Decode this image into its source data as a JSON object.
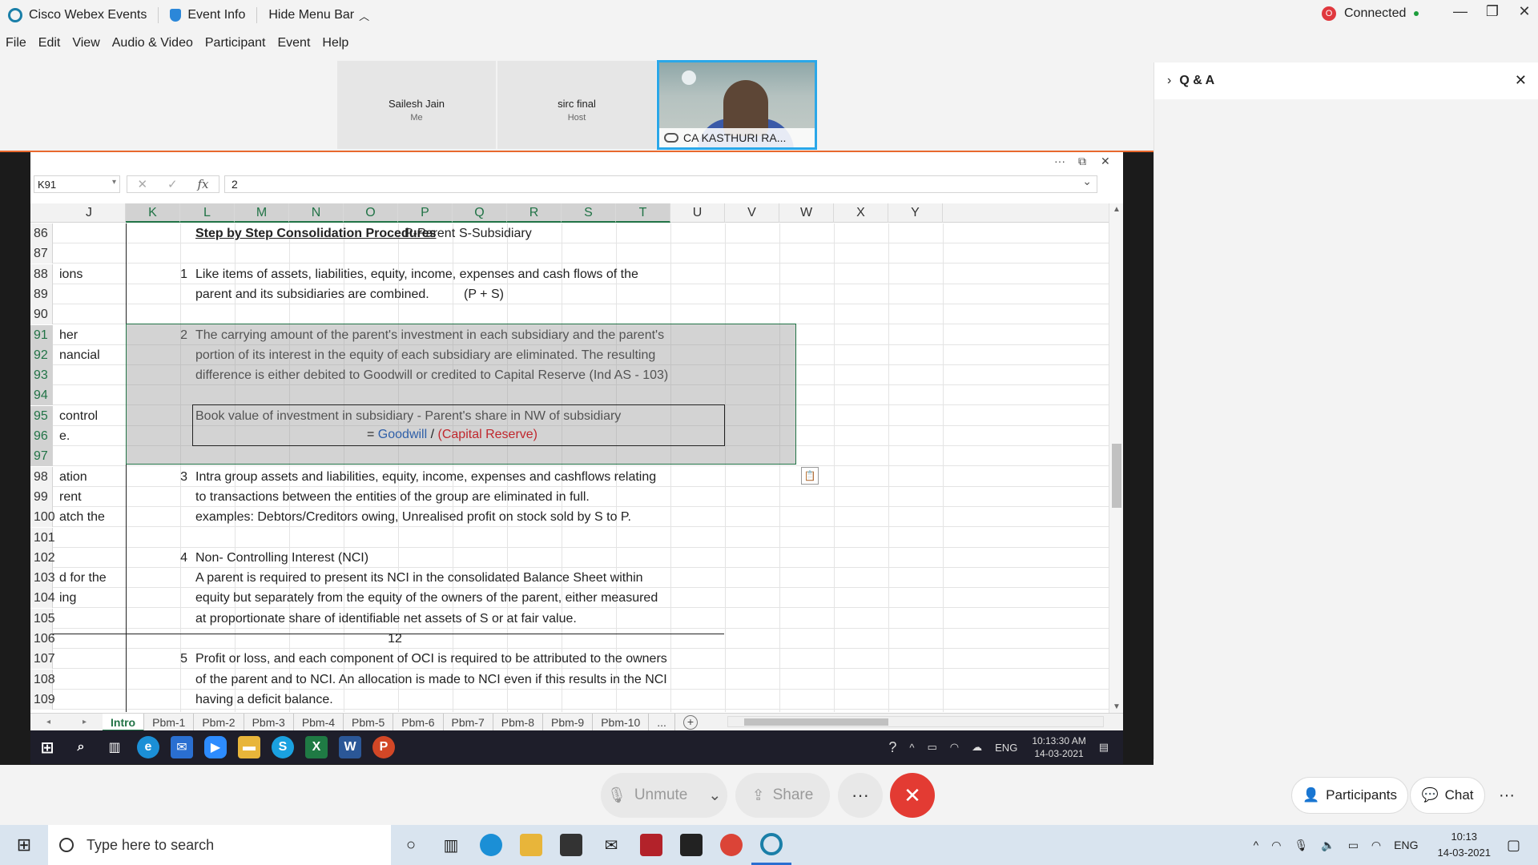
{
  "titlebar": {
    "app_name": "Cisco Webex Events",
    "event_info": "Event Info",
    "hide_menu": "Hide Menu Bar",
    "status": "Connected",
    "status_badge": "O"
  },
  "menu": [
    "File",
    "Edit",
    "View",
    "Audio & Video",
    "Participant",
    "Event",
    "Help"
  ],
  "participants": [
    {
      "name": "Sailesh Jain",
      "role": "Me"
    },
    {
      "name": "sirc final",
      "role": "Host"
    }
  ],
  "active_speaker": {
    "name": "CA KASTHURI RA..."
  },
  "qa_panel": {
    "title": "Q & A"
  },
  "excel": {
    "name_box": "K91",
    "formula_value": "2",
    "columns": [
      "J",
      "K",
      "L",
      "M",
      "N",
      "O",
      "P",
      "Q",
      "R",
      "S",
      "T",
      "U",
      "V",
      "W",
      "X",
      "Y"
    ],
    "rows": [
      {
        "n": "86",
        "j": "",
        "k": "",
        "t": "Step by Step Consolidation Procedures",
        "t2": "P-Parent",
        "t3": "S-Subsidiary"
      },
      {
        "n": "87",
        "j": "",
        "k": "",
        "t": ""
      },
      {
        "n": "88",
        "j": "ions",
        "k": "1",
        "t": "Like items of assets, liabilities, equity, income, expenses and cash flows of the"
      },
      {
        "n": "89",
        "j": "",
        "k": "",
        "t": "parent and its subsidiaries are combined.",
        "t3": "(P + S)"
      },
      {
        "n": "90",
        "j": "",
        "k": "",
        "t": ""
      },
      {
        "n": "91",
        "j": "her",
        "k": "2",
        "t": "The carrying amount of the parent's investment in each subsidiary and the parent's"
      },
      {
        "n": "92",
        "j": "nancial",
        "k": "",
        "t": "portion of its interest in the equity of each subsidiary are eliminated.  The resulting"
      },
      {
        "n": "93",
        "j": "",
        "k": "",
        "t": "difference is either debited to Goodwill or credited to Capital Reserve (Ind AS - 103)"
      },
      {
        "n": "94",
        "j": "",
        "k": "",
        "t": ""
      },
      {
        "n": "95",
        "j": "control",
        "k": "",
        "t": "Book value of investment in subsidiary - Parent's share in NW of subsidiary"
      },
      {
        "n": "96",
        "j": "e.",
        "k": "",
        "t": ""
      },
      {
        "n": "97",
        "j": "",
        "k": "",
        "t": ""
      },
      {
        "n": "98",
        "j": "ation",
        "k": "3",
        "t": "Intra group assets and liabilities, equity, income, expenses and cashflows relating"
      },
      {
        "n": "99",
        "j": "rent",
        "k": "",
        "t": "to transactions between the entities of the group are eliminated in full."
      },
      {
        "n": "100",
        "j": "atch the",
        "k": "",
        "t": "examples: Debtors/Creditors owing, Unrealised profit on stock sold by S to P."
      },
      {
        "n": "101",
        "j": "",
        "k": "",
        "t": ""
      },
      {
        "n": "102",
        "j": "",
        "k": "4",
        "t": "Non- Controlling Interest (NCI)"
      },
      {
        "n": "103",
        "j": "d for the",
        "k": "",
        "t": "A parent is required to present its NCI in the consolidated Balance Sheet within"
      },
      {
        "n": "104",
        "j": "ing",
        "k": "",
        "t": "equity but separately from the equity of the owners of the parent, either measured"
      },
      {
        "n": "105",
        "j": "",
        "k": "",
        "t": "at proportionate share of identifiable net assets of S or at fair value."
      },
      {
        "n": "106",
        "j": "",
        "k": "",
        "t": "",
        "mid": "12"
      },
      {
        "n": "107",
        "j": "",
        "k": "5",
        "t": "Profit or loss, and each component of OCI is required to be attributed to the owners"
      },
      {
        "n": "108",
        "j": "",
        "k": "",
        "t": "of the parent and to NCI.  An allocation is made to NCI even if this results in the NCI"
      },
      {
        "n": "109",
        "j": "",
        "k": "",
        "t": "having a deficit balance."
      }
    ],
    "formula_line": {
      "eq": "=",
      "goodwill": "Goodwill",
      "slash": "/",
      "capital": "(Capital Reserve)",
      "goodwill_color": "#2e5fa8",
      "capital_color": "#c0272d"
    },
    "sheets": [
      "Intro",
      "Pbm-1",
      "Pbm-2",
      "Pbm-3",
      "Pbm-4",
      "Pbm-5",
      "Pbm-6",
      "Pbm-7",
      "Pbm-8",
      "Pbm-9",
      "Pbm-10",
      "..."
    ],
    "active_sheet": "Intro"
  },
  "inner_taskbar": {
    "lang": "ENG",
    "time": "10:13:30 AM",
    "date": "14-03-2021"
  },
  "controls": {
    "unmute": "Unmute",
    "share": "Share",
    "more": "···",
    "participants": "Participants",
    "chat": "Chat"
  },
  "os_taskbar": {
    "search_placeholder": "Type here to search",
    "lang": "ENG",
    "time": "10:13",
    "date": "14-03-2021"
  }
}
